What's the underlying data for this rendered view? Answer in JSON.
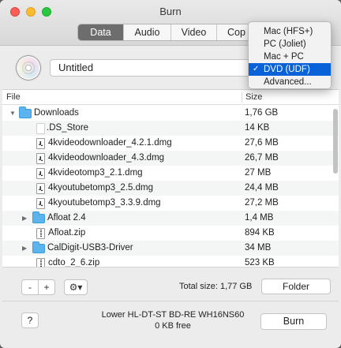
{
  "window": {
    "title": "Burn"
  },
  "tabs": [
    {
      "label": "Data",
      "active": true
    },
    {
      "label": "Audio",
      "active": false
    },
    {
      "label": "Video",
      "active": false
    },
    {
      "label": "Cop",
      "active": false
    }
  ],
  "disc": {
    "name": "Untitled"
  },
  "table": {
    "headers": {
      "file": "File",
      "size": "Size"
    },
    "rows": [
      {
        "name": "Downloads",
        "size": "1,76 GB",
        "kind": "folder",
        "expanded": true
      },
      {
        "name": ".DS_Store",
        "size": "14 KB",
        "kind": "blank"
      },
      {
        "name": "4kvideodownloader_4.2.1.dmg",
        "size": "27,6 MB",
        "kind": "dmg"
      },
      {
        "name": "4kvideodownloader_4.3.dmg",
        "size": "26,7 MB",
        "kind": "dmg"
      },
      {
        "name": "4kvideotomp3_2.1.dmg",
        "size": "27 MB",
        "kind": "dmg"
      },
      {
        "name": "4kyoutubetomp3_2.5.dmg",
        "size": "24,4 MB",
        "kind": "dmg"
      },
      {
        "name": "4kyoutubetomp3_3.3.9.dmg",
        "size": "27,2 MB",
        "kind": "dmg"
      },
      {
        "name": "Afloat 2.4",
        "size": "1,4 MB",
        "kind": "folder",
        "expanded": false
      },
      {
        "name": "Afloat.zip",
        "size": "894 KB",
        "kind": "zip"
      },
      {
        "name": "CalDigit-USB3-Driver",
        "size": "34 MB",
        "kind": "folder",
        "expanded": false
      },
      {
        "name": "cdto_2_6.zip",
        "size": "523 KB",
        "kind": "zip"
      }
    ]
  },
  "toolbar": {
    "minus_label": "-",
    "plus_label": "+",
    "gear_label": "⚙▾",
    "total_size": "Total size: 1,77 GB",
    "folder_label": "Folder"
  },
  "footer": {
    "help_label": "?",
    "drive_name": "Lower HL-DT-ST BD-RE WH16NS60",
    "drive_free": "0 KB free",
    "burn_label": "Burn"
  },
  "format_menu": {
    "items": [
      {
        "label": "Mac (HFS+)",
        "selected": false
      },
      {
        "label": "PC (Joliet)",
        "selected": false
      },
      {
        "label": "Mac + PC",
        "selected": false
      },
      {
        "label": "DVD (UDF)",
        "selected": true
      },
      {
        "label": "Advanced...",
        "selected": false
      }
    ],
    "check_mark": "✓"
  }
}
